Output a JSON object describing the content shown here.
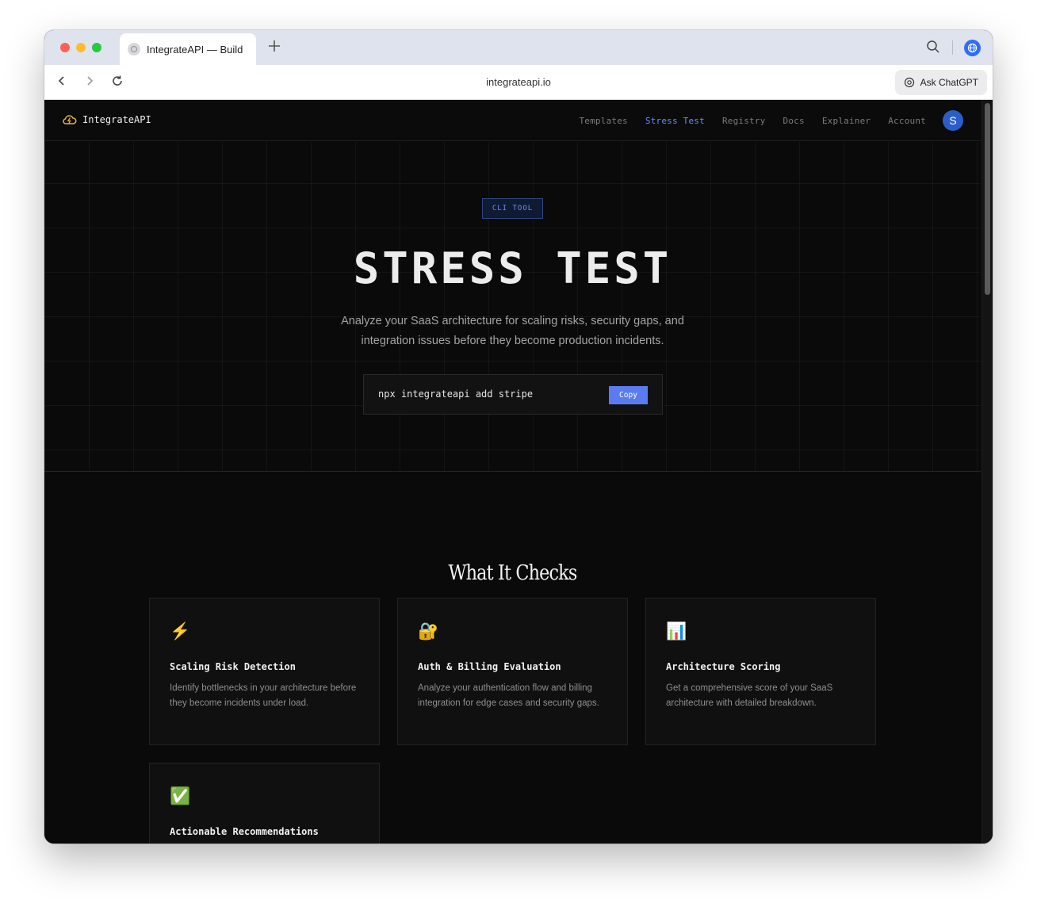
{
  "browser": {
    "tab_title": "IntegrateAPI — Build",
    "url": "integrateapi.io",
    "ask_button_label": "Ask ChatGPT",
    "icons": [
      "back-icon",
      "forward-icon",
      "reload-icon",
      "search-icon",
      "globe-icon",
      "plus-icon"
    ]
  },
  "site": {
    "logo_text": "IntegrateAPI",
    "nav": {
      "templates": "Templates",
      "stress_test": "Stress Test",
      "registry": "Registry",
      "docs": "Docs",
      "explainer": "Explainer",
      "account": "Account"
    },
    "avatar_initial": "S",
    "accent_color": "#6b8cff"
  },
  "hero": {
    "badge": "CLI TOOL",
    "title": "STRESS TEST",
    "subtitle_line1": "Analyze your SaaS architecture for scaling risks, security gaps, and",
    "subtitle_line2": "integration issues before they become production incidents.",
    "command": "npx integrateapi add stripe",
    "copy_label": "Copy"
  },
  "checks": {
    "title": "What It Checks",
    "cards": [
      {
        "icon": "⚡",
        "title": "Scaling Risk Detection",
        "desc": "Identify bottlenecks in your architecture before they become incidents under load."
      },
      {
        "icon": "🔐",
        "title": "Auth & Billing Evaluation",
        "desc": "Analyze your authentication flow and billing integration for edge cases and security gaps."
      },
      {
        "icon": "📊",
        "title": "Architecture Scoring",
        "desc": "Get a comprehensive score of your SaaS architecture with detailed breakdown."
      },
      {
        "icon": "✅",
        "title": "Actionable Recommendations",
        "desc": ""
      }
    ]
  }
}
